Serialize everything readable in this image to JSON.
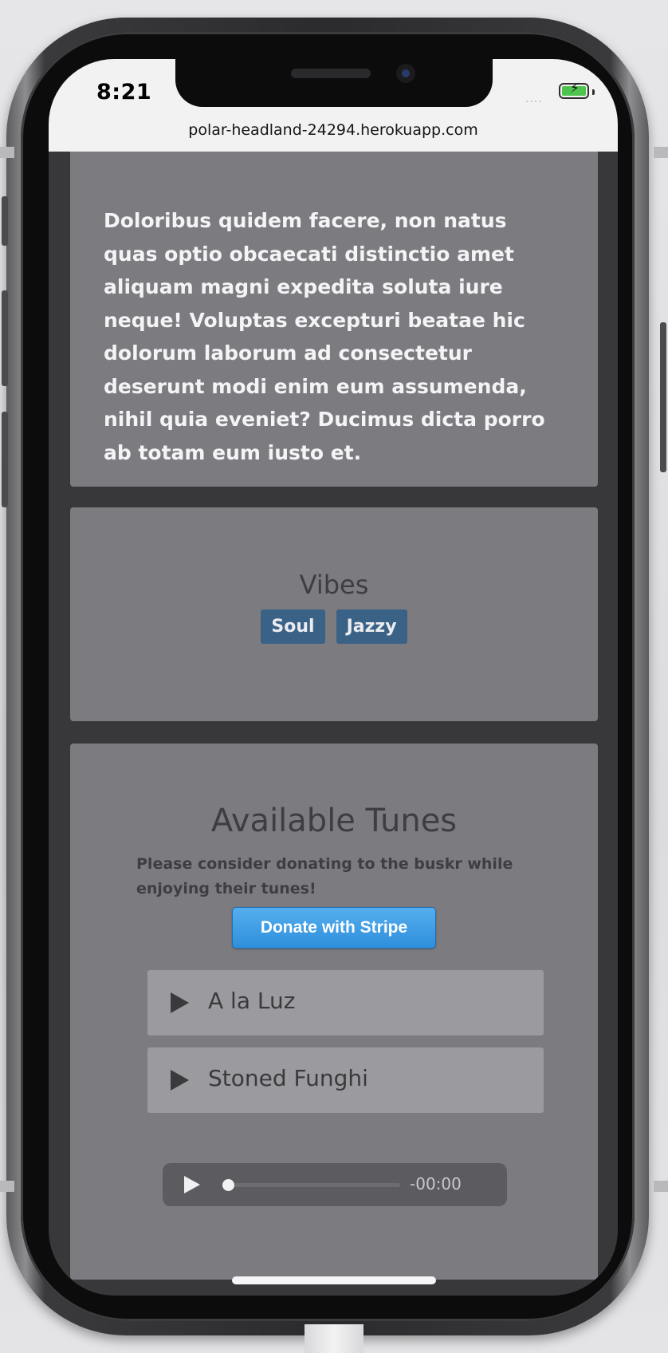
{
  "status_bar": {
    "time": "8:21",
    "signal": "....",
    "battery_state": "charging"
  },
  "browser": {
    "url": "polar-headland-24294.herokuapp.com"
  },
  "description": {
    "text": "Doloribus quidem facere, non natus quas optio obcaecati distinctio amet aliquam magni expedita soluta iure neque! Voluptas excepturi beatae hic dolorum laborum ad consectetur deserunt modi enim eum assumenda, nihil quia eveniet? Ducimus dicta porro ab totam eum iusto et."
  },
  "vibes": {
    "title": "Vibes",
    "tags": [
      "Soul",
      "Jazzy"
    ]
  },
  "tunes": {
    "title": "Available Tunes",
    "donate_note": "Please consider donating to the buskr while enjoying their tunes!",
    "donate_button": "Donate with Stripe",
    "tracks": [
      "A la Luz",
      "Stoned Funghi"
    ],
    "player": {
      "time": "-00:00",
      "progress": 0
    }
  },
  "colors": {
    "card": "#7b7b80",
    "page_background": "#38383b",
    "tag": "#3a6186",
    "donate_button": "#3a9ae4",
    "track_row": "#9b9b9f",
    "audio_player": "#5c5c60"
  }
}
